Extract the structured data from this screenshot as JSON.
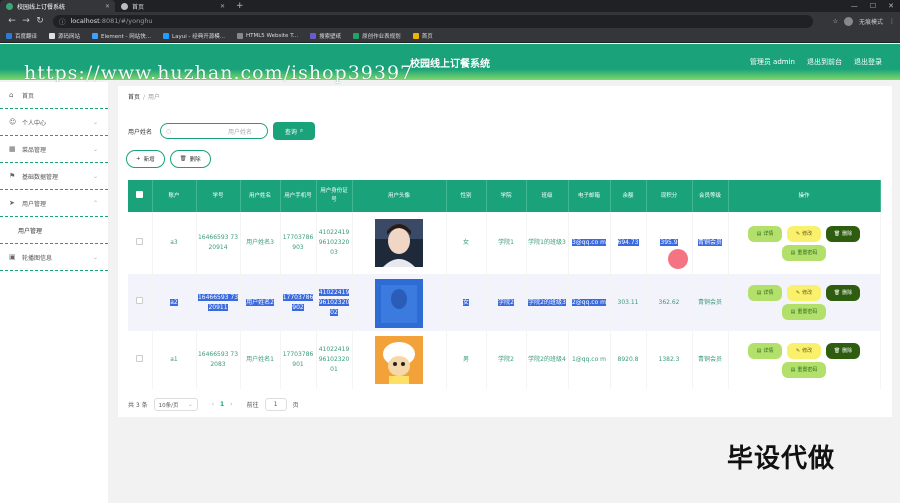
{
  "browser": {
    "tabs": [
      {
        "label": "校园线上订餐系统",
        "active": true,
        "color": "#3ba776"
      },
      {
        "label": "首页",
        "active": false,
        "color": "#bbbbbb"
      }
    ],
    "url_host": "localhost",
    "url_rest": ":8081/#/yonghu",
    "profile": "无痕模式",
    "bookmarks": [
      "百度翻译",
      "源码网站",
      "Element - 网站快...",
      "Layui - 经典开源模...",
      "HTML5 Website T...",
      "搜索壁纸",
      "原创作业表规划",
      "首页"
    ]
  },
  "header": {
    "title": "校园线上订餐系统",
    "links": [
      "管理员 admin",
      "退出到前台",
      "退出登录"
    ]
  },
  "watermark": "https://www.huzhan.com/ishop39397",
  "sidebar": {
    "items": [
      {
        "label": "首页",
        "icon": "home-icon",
        "glyph": "⌂"
      },
      {
        "label": "个人中心",
        "icon": "user-icon",
        "glyph": "☺"
      },
      {
        "label": "菜品管理",
        "icon": "grid-icon",
        "glyph": "▦"
      },
      {
        "label": "基础数据管理",
        "icon": "flag-icon",
        "glyph": "⚑"
      },
      {
        "label": "用户管理",
        "icon": "send-icon",
        "glyph": "➤"
      },
      {
        "label": "用户管理",
        "sub": true
      },
      {
        "label": "轮播图信息",
        "icon": "image-icon",
        "glyph": "▣"
      }
    ]
  },
  "breadcrumb": {
    "home": "首页",
    "sep": "/",
    "current": "用户"
  },
  "search": {
    "label": "用户姓名",
    "placeholder": "用户姓名",
    "button": "查询"
  },
  "actions": {
    "add": "新增",
    "delete": "删除"
  },
  "table": {
    "headers": [
      "账户",
      "学号",
      "用户姓名",
      "用户手机号",
      "用户身份证号",
      "用户头像",
      "性别",
      "学院",
      "班级",
      "电子邮箱",
      "余额",
      "现积分",
      "会员等级",
      "操作"
    ],
    "rows": [
      {
        "account": "a3",
        "student_no": "16466593 7320914",
        "name": "用户姓名3",
        "phone": "17703786 903",
        "idcard": "41022419 96102320 03",
        "gender": "女",
        "college": "学院1",
        "class": "学院1的班级3",
        "email": "3@qq.co m",
        "balance": "694.73",
        "points": "395.9",
        "level": "青铜会员"
      },
      {
        "account": "a2",
        "student_no": "16466593 7320911",
        "name": "用户姓名2",
        "phone": "17703786 902",
        "idcard": "41022419 96102320 02",
        "gender": "女",
        "college": "学院2",
        "class": "学院2的班级3",
        "email": "2@qq.co m",
        "balance": "303.11",
        "points": "362.62",
        "level": "青铜会员"
      },
      {
        "account": "a1",
        "student_no": "16466593 732083",
        "name": "用户姓名1",
        "phone": "17703786 901",
        "idcard": "41022419 96102320 01",
        "gender": "男",
        "college": "学院2",
        "class": "学院2的班级4",
        "email": "1@qq.co m",
        "balance": "8920.8",
        "points": "1382.3",
        "level": "青铜会员"
      }
    ],
    "ops": {
      "detail": "详情",
      "edit": "修改",
      "delete": "删除",
      "reset": "重置密码"
    }
  },
  "pagination": {
    "total": "共 3 条",
    "page_size": "10条/页",
    "prev": "‹",
    "page": "1",
    "next": "›",
    "goto": "前往",
    "goto_value": "1",
    "page_unit": "页"
  },
  "stamp": "毕设代做",
  "colors": {
    "primary": "#1aa37a",
    "accent_light": "#7fd86a",
    "delete_btn": "#2e5d10",
    "edit_btn": "#f9f06c",
    "detail_btn": "#b3e06a"
  }
}
